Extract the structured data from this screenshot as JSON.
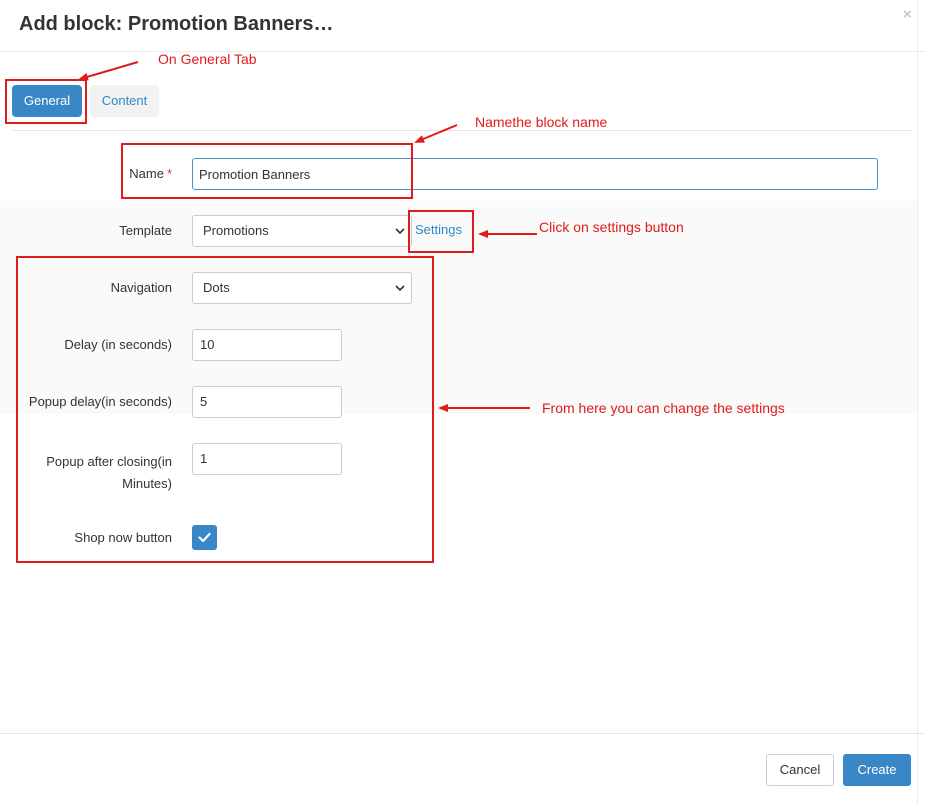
{
  "dialog": {
    "title": "Add block: Promotion Banners…",
    "close_glyph": "×"
  },
  "tabs": [
    {
      "label": "General",
      "active": true
    },
    {
      "label": "Content",
      "active": false
    }
  ],
  "form": {
    "name": {
      "label": "Name",
      "required_mark": "*",
      "value": "Promotion Banners"
    },
    "template": {
      "label": "Template",
      "value": "Promotions",
      "settings_link": "Settings"
    },
    "navigation": {
      "label": "Navigation",
      "value": "Dots"
    },
    "delay": {
      "label": "Delay (in seconds)",
      "value": "10"
    },
    "popup_delay": {
      "label": "Popup delay(in seconds)",
      "value": "5"
    },
    "popup_after": {
      "label_line1": "Popup after closing(in",
      "label_line2": "Minutes)",
      "value": "1"
    },
    "shop_now": {
      "label": "Shop now button",
      "checked": true
    }
  },
  "annotations": {
    "general_tab": "On General Tab",
    "block_name": "Namethe block name",
    "settings_button": "Click on settings button",
    "change_settings": "From here you can change the settings",
    "color": "#e01b1b"
  },
  "footer": {
    "cancel_label": "Cancel",
    "create_label": "Create"
  },
  "colors": {
    "accent": "#3a87c8",
    "link": "#2d89c8"
  }
}
